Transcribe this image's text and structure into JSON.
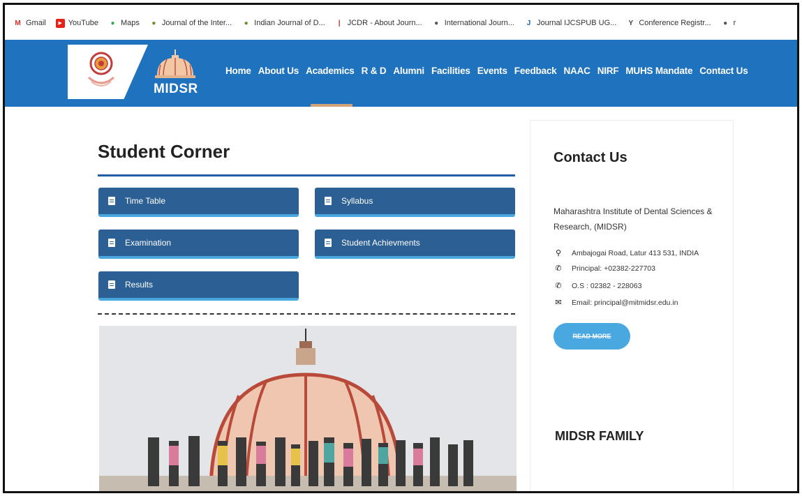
{
  "bookmarks": [
    {
      "label": "Gmail",
      "color": "#d93025",
      "glyph": "M"
    },
    {
      "label": "YouTube",
      "color": "#e62117",
      "glyph": "▶"
    },
    {
      "label": "Maps",
      "color": "#34a853",
      "glyph": "●"
    },
    {
      "label": "Journal of the Inter...",
      "color": "#6b8e23",
      "glyph": "●"
    },
    {
      "label": "Indian Journal of D...",
      "color": "#6b8e23",
      "glyph": "●"
    },
    {
      "label": "JCDR - About Journ...",
      "color": "#c62828",
      "glyph": "|"
    },
    {
      "label": "International Journ...",
      "color": "#555555",
      "glyph": "●"
    },
    {
      "label": "Journal IJCSPUB UG...",
      "color": "#1565c0",
      "glyph": "J"
    },
    {
      "label": "Conference Registr...",
      "color": "#444444",
      "glyph": "Y"
    },
    {
      "label": "r",
      "color": "#555555",
      "glyph": "●"
    }
  ],
  "site": {
    "logo_text": "MIDSR",
    "brand_color": "#1f72bd",
    "nav": [
      "Home",
      "About Us",
      "Academics",
      "R & D",
      "Alumni",
      "Facilities",
      "Events",
      "Feedback",
      "NAAC",
      "NIRF",
      "MUHS Mandate",
      "Contact Us"
    ]
  },
  "main": {
    "title": "Student Corner",
    "buttons": {
      "time_table": "Time Table",
      "syllabus": "Syllabus",
      "examination": "Examination",
      "achievements": "Student Achievments",
      "results": "Results"
    }
  },
  "sidebar": {
    "contact_title": "Contact Us",
    "institute": "Maharashtra Institute of Dental Sciences & Research, (MIDSR)",
    "address": "Ambajogai Road, Latur 413 531, INDIA",
    "principal": "Principal: +02382-227703",
    "os": "O.S : 02382 - 228063",
    "email": "Email: principal@mitmidsr.edu.in",
    "read_more": "READ MORE",
    "family_title": "MIDSR FAMILY"
  }
}
